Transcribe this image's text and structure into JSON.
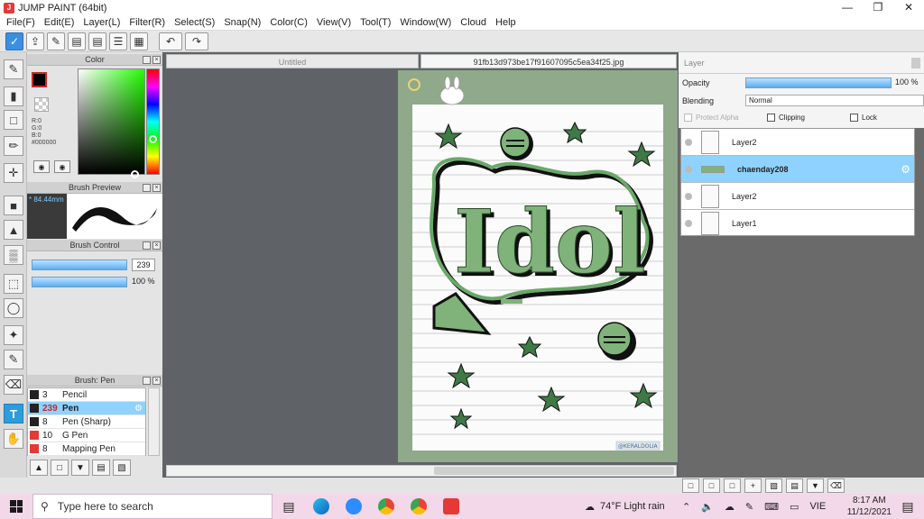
{
  "window": {
    "title": "JUMP PAINT (64bit)"
  },
  "menu": [
    "File(F)",
    "Edit(E)",
    "Layer(L)",
    "Filter(R)",
    "Select(S)",
    "Snap(N)",
    "Color(C)",
    "View(V)",
    "Tool(T)",
    "Window(W)",
    "Cloud",
    "Help"
  ],
  "panels": {
    "color": {
      "title": "Color",
      "r": "R:0",
      "g": "G:0",
      "b": "B:0",
      "hex": "#000000",
      "fg": "#000000",
      "bg": "#ffffff"
    },
    "brush_preview": {
      "title": "Brush Preview",
      "size": "* 84.44mm"
    },
    "brush_control": {
      "title": "Brush Control",
      "size_value": "239",
      "opacity_value": "100 %"
    },
    "brush_list": {
      "title": "Brush: Pen",
      "items": [
        {
          "size": "3",
          "name": "Pencil",
          "color": "#222222"
        },
        {
          "size": "239",
          "name": "Pen",
          "color": "#222222",
          "selected": true
        },
        {
          "size": "8",
          "name": "Pen (Sharp)",
          "color": "#222222"
        },
        {
          "size": "10",
          "name": "G Pen",
          "color": "#e53935"
        },
        {
          "size": "8",
          "name": "Mapping Pen",
          "color": "#e53935"
        }
      ]
    }
  },
  "documents": {
    "tabs": [
      {
        "label": "Untitled",
        "active": false
      },
      {
        "label": "91fb13d973be17f91607095c5ea34f25.jpg",
        "active": true
      }
    ]
  },
  "layer_panel": {
    "title": "Layer",
    "opacity_label": "Opacity",
    "opacity_value": "100 %",
    "opacity_fraction": 1.0,
    "blending_label": "Blending",
    "blending_value": "Normal",
    "protect_alpha": "Protect Alpha",
    "clipping": "Clipping",
    "lock": "Lock",
    "layers": [
      {
        "name": "Layer2",
        "selected": false
      },
      {
        "name": "chaenday208",
        "selected": true
      },
      {
        "name": "Layer2",
        "selected": false
      },
      {
        "name": "Layer1",
        "selected": false
      }
    ]
  },
  "artwork": {
    "word": "Idol",
    "watermark": "@KERALDOLIA"
  },
  "taskbar": {
    "search_placeholder": "Type here to search",
    "weather": "74°F  Light rain",
    "language": "VIE",
    "time": "8:17 AM",
    "date": "11/12/2021"
  }
}
